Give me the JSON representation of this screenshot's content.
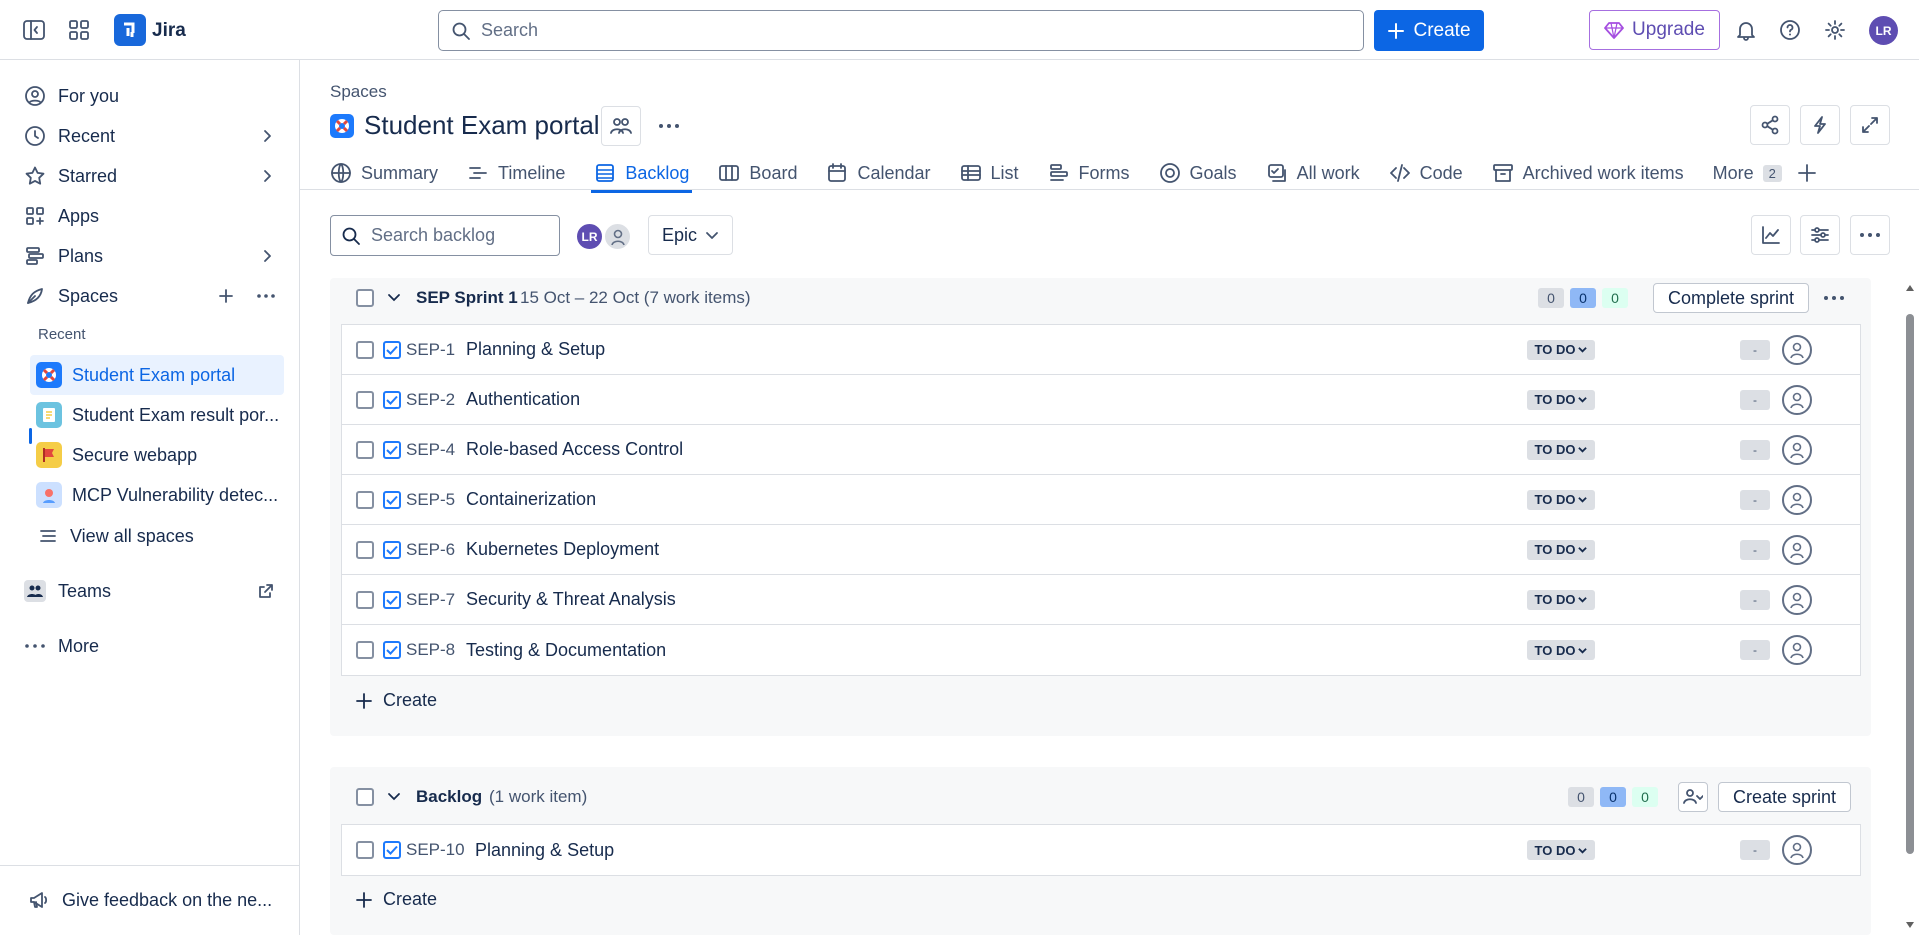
{
  "app": {
    "name": "Jira"
  },
  "topbar": {
    "search_placeholder": "Search",
    "create_label": "Create",
    "upgrade_label": "Upgrade",
    "avatar_initials": "LR"
  },
  "sidebar": {
    "for_you": "For you",
    "recent": "Recent",
    "starred": "Starred",
    "apps": "Apps",
    "plans": "Plans",
    "spaces": "Spaces",
    "recent_heading": "Recent",
    "spaces_list": [
      {
        "name": "Student Exam portal",
        "icon": "lifebuoy-icon",
        "color": "#1d7afc"
      },
      {
        "name": "Student Exam result por...",
        "icon": "notepad-icon",
        "color": "#6cc3e0"
      },
      {
        "name": "Secure webapp",
        "icon": "flag-icon",
        "color": "#f5cd47"
      },
      {
        "name": "MCP Vulnerability detec...",
        "icon": "person-icon",
        "color": "#cce0ff"
      }
    ],
    "view_all_spaces": "View all spaces",
    "teams": "Teams",
    "more": "More",
    "feedback": "Give feedback on the ne..."
  },
  "header": {
    "breadcrumb": "Spaces",
    "title": "Student Exam portal",
    "tabs": [
      {
        "label": "Summary",
        "icon": "globe-icon"
      },
      {
        "label": "Timeline",
        "icon": "timeline-icon"
      },
      {
        "label": "Backlog",
        "icon": "backlog-icon",
        "active": true
      },
      {
        "label": "Board",
        "icon": "board-icon"
      },
      {
        "label": "Calendar",
        "icon": "calendar-icon"
      },
      {
        "label": "List",
        "icon": "list-icon"
      },
      {
        "label": "Forms",
        "icon": "forms-icon"
      },
      {
        "label": "Goals",
        "icon": "goals-icon"
      },
      {
        "label": "All work",
        "icon": "allwork-icon"
      },
      {
        "label": "Code",
        "icon": "code-icon"
      },
      {
        "label": "Archived work items",
        "icon": "archive-icon"
      }
    ],
    "more_label": "More",
    "more_count": "2"
  },
  "toolbar": {
    "search_placeholder": "Search backlog",
    "avatar_initials": "LR",
    "epic_label": "Epic"
  },
  "sprint": {
    "name": "SEP Sprint 1",
    "dates": "15 Oct – 22 Oct (7 work items)",
    "counts": {
      "todo": "0",
      "in_progress": "0",
      "done": "0"
    },
    "complete_label": "Complete sprint",
    "create_label": "Create",
    "items": [
      {
        "key": "SEP-1",
        "summary": "Planning & Setup",
        "status": "TO DO",
        "estimate": "-"
      },
      {
        "key": "SEP-2",
        "summary": "Authentication",
        "status": "TO DO",
        "estimate": "-"
      },
      {
        "key": "SEP-4",
        "summary": "Role-based Access Control",
        "status": "TO DO",
        "estimate": "-"
      },
      {
        "key": "SEP-5",
        "summary": "Containerization",
        "status": "TO DO",
        "estimate": "-"
      },
      {
        "key": "SEP-6",
        "summary": "Kubernetes Deployment",
        "status": "TO DO",
        "estimate": "-"
      },
      {
        "key": "SEP-7",
        "summary": "Security & Threat Analysis",
        "status": "TO DO",
        "estimate": "-"
      },
      {
        "key": "SEP-8",
        "summary": "Testing & Documentation",
        "status": "TO DO",
        "estimate": "-"
      }
    ]
  },
  "backlog": {
    "name": "Backlog",
    "count_text": "(1 work item)",
    "counts": {
      "todo": "0",
      "in_progress": "0",
      "done": "0"
    },
    "create_sprint_label": "Create sprint",
    "create_label": "Create",
    "items": [
      {
        "key": "SEP-10",
        "summary": "Planning & Setup",
        "status": "TO DO",
        "estimate": "-"
      }
    ]
  },
  "colors": {
    "accent": "#0c66e4",
    "upgrade": "#5e4db2",
    "avatar": "#5e4db2"
  }
}
